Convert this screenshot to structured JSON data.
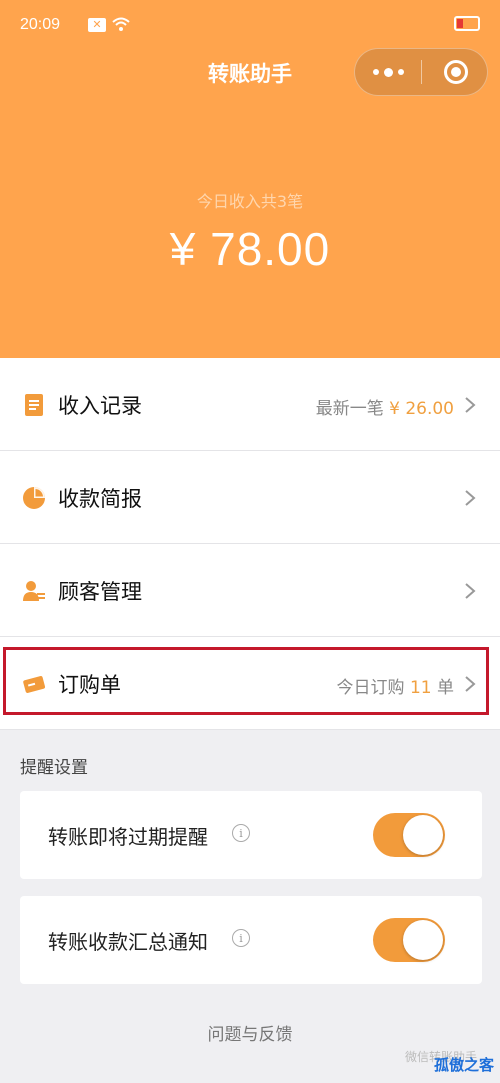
{
  "status_bar": {
    "time": "20:09",
    "notification_icon": "close-x-icon"
  },
  "header": {
    "title": "转账助手",
    "background_color": "#ffa44d"
  },
  "summary": {
    "label": "今日收入共3笔",
    "amount": "¥ 78.00"
  },
  "menu": [
    {
      "label": "收入记录",
      "icon": "document-icon",
      "right_prefix": "最新一笔 ",
      "right_value": "¥ 26.00",
      "right_suffix": ""
    },
    {
      "label": "收款简报",
      "icon": "pie-chart-icon",
      "right_prefix": "",
      "right_value": "",
      "right_suffix": ""
    },
    {
      "label": "顾客管理",
      "icon": "user-card-icon",
      "right_prefix": "",
      "right_value": "",
      "right_suffix": ""
    },
    {
      "label": "订购单",
      "icon": "ticket-icon",
      "right_prefix": "今日订购 ",
      "right_value": "11",
      "right_suffix": " 单"
    }
  ],
  "reminders": {
    "title": "提醒设置",
    "items": [
      {
        "label": "转账即将过期提醒",
        "enabled": true
      },
      {
        "label": "转账收款汇总通知",
        "enabled": true
      }
    ]
  },
  "footer": {
    "feedback": "问题与反馈",
    "watermark": "微信转账助手",
    "brand": "孤傲之客"
  },
  "colors": {
    "accent": "#f29b3b",
    "highlight_border": "#c4182b"
  }
}
